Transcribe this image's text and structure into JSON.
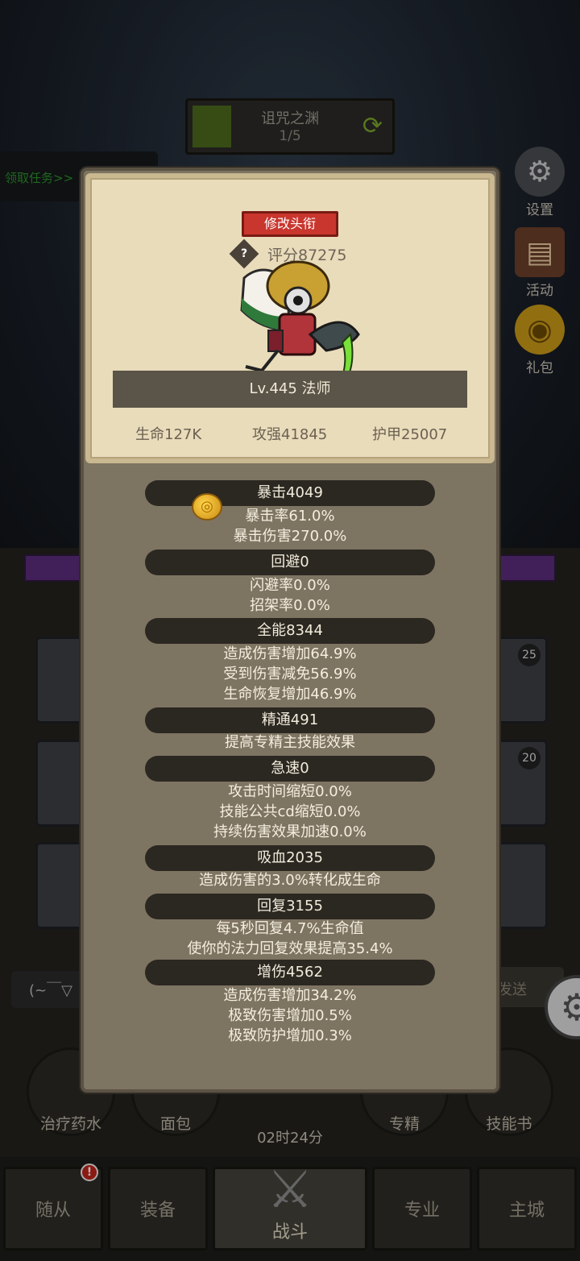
{
  "dungeon": {
    "name": "诅咒之渊",
    "progress": "1/5"
  },
  "task_button": "领取任务>>",
  "side_menu": [
    {
      "label": "设置",
      "icon": "gear-icon"
    },
    {
      "label": "活动",
      "icon": "scroll-icon"
    },
    {
      "label": "礼包",
      "icon": "gift-icon"
    }
  ],
  "slot_numbers": [
    "25",
    "20"
  ],
  "chat_placeholder": "(~￣▽",
  "send_label": "发送",
  "items": [
    {
      "label": "治疗药水",
      "icon": "potion-icon"
    },
    {
      "label": "面包",
      "icon": "bread-icon"
    },
    {
      "label": "专精",
      "icon": "spec-icon"
    },
    {
      "label": "技能书",
      "icon": "skillbook-icon"
    }
  ],
  "timer": "02时24分",
  "nav": [
    "随从",
    "装备",
    "战斗",
    "专业",
    "主城"
  ],
  "nav_badge": "!",
  "panel": {
    "title_button": "修改头衔",
    "score": "评分87275",
    "level_class": "Lv.445 法师",
    "basic_stats": [
      "生命127K",
      "攻强41845",
      "护甲25007"
    ],
    "stats": [
      {
        "head": "暴击4049",
        "lines": [
          "暴击率61.0%",
          "暴击伤害270.0%"
        ]
      },
      {
        "head": "回避0",
        "lines": [
          "闪避率0.0%",
          "招架率0.0%"
        ]
      },
      {
        "head": "全能8344",
        "lines": [
          "造成伤害增加64.9%",
          "受到伤害减免56.9%",
          "生命恢复增加46.9%"
        ]
      },
      {
        "head": "精通491",
        "lines": [
          "提高专精主技能效果"
        ]
      },
      {
        "head": "急速0",
        "lines": [
          "攻击时间缩短0.0%",
          "技能公共cd缩短0.0%",
          "持续伤害效果加速0.0%"
        ]
      },
      {
        "head": "吸血2035",
        "lines": [
          "造成伤害的3.0%转化成生命"
        ]
      },
      {
        "head": "回复3155",
        "lines": [
          "每5秒回复4.7%生命值",
          "使你的法力回复效果提高35.4%"
        ]
      },
      {
        "head": "增伤4562",
        "lines": [
          "造成伤害增加34.2%",
          "极致伤害增加0.5%",
          "极致防护增加0.3%"
        ]
      }
    ]
  }
}
